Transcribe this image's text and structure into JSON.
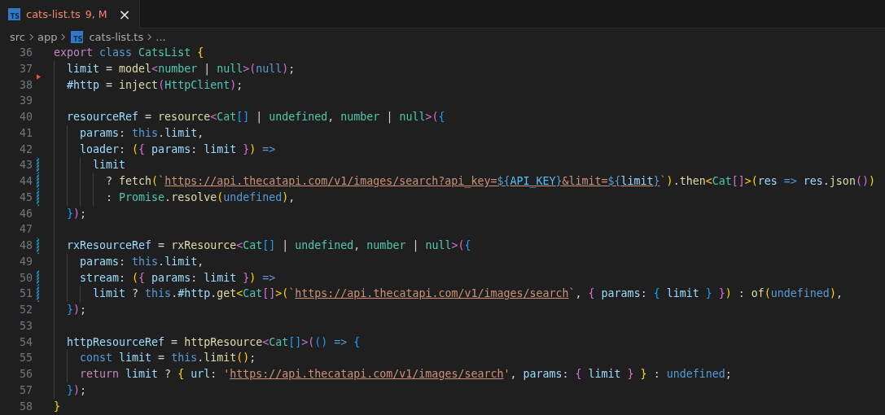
{
  "tabs": [
    {
      "icon_text": "TS",
      "label": "cats-list.ts",
      "status": "9, M",
      "close": "×",
      "selected": true
    }
  ],
  "breadcrumb": [
    {
      "text": "src"
    },
    {
      "text": "app"
    },
    {
      "text": "cats-list.ts",
      "icon_text": "TS"
    },
    {
      "text": "..."
    }
  ],
  "lines": [
    {
      "number": "36",
      "modified": false,
      "deleted_above": false,
      "tokens": [
        {
          "text": "export ",
          "kind": "ctl"
        },
        {
          "text": "class ",
          "kind": "kw"
        },
        {
          "text": "CatsList ",
          "kind": "ty"
        },
        {
          "text": "{",
          "kind": "b1"
        }
      ]
    },
    {
      "number": "37",
      "modified": false,
      "deleted_above": false,
      "tokens": [
        {
          "text": "  limit",
          "kind": "var"
        },
        {
          "text": " = ",
          "kind": "plain"
        },
        {
          "text": "model",
          "kind": "fn"
        },
        {
          "text": "<",
          "kind": "b2"
        },
        {
          "text": "number",
          "kind": "ty"
        },
        {
          "text": " | ",
          "kind": "plain"
        },
        {
          "text": "null",
          "kind": "ty"
        },
        {
          "text": ">(",
          "kind": "b2"
        },
        {
          "text": "null",
          "kind": "kw"
        },
        {
          "text": ")",
          "kind": "b2"
        },
        {
          "text": ";",
          "kind": "plain"
        }
      ]
    },
    {
      "number": "38",
      "modified": false,
      "deleted_above": true,
      "tokens": [
        {
          "text": "  #http",
          "kind": "var"
        },
        {
          "text": " = ",
          "kind": "plain"
        },
        {
          "text": "inject",
          "kind": "fn"
        },
        {
          "text": "(",
          "kind": "b2"
        },
        {
          "text": "HttpClient",
          "kind": "ty"
        },
        {
          "text": ")",
          "kind": "b2"
        },
        {
          "text": ";",
          "kind": "plain"
        }
      ]
    },
    {
      "number": "39",
      "modified": false,
      "deleted_above": false
    },
    {
      "number": "40",
      "modified": false,
      "deleted_above": false,
      "tokens": [
        {
          "text": "  resourceRef",
          "kind": "var"
        },
        {
          "text": " = ",
          "kind": "plain"
        },
        {
          "text": "resource",
          "kind": "fn"
        },
        {
          "text": "<",
          "kind": "b2"
        },
        {
          "text": "Cat",
          "kind": "ty"
        },
        {
          "text": "[]",
          "kind": "b3"
        },
        {
          "text": " | ",
          "kind": "plain"
        },
        {
          "text": "undefined",
          "kind": "ty"
        },
        {
          "text": ", ",
          "kind": "plain"
        },
        {
          "text": "number",
          "kind": "ty"
        },
        {
          "text": " | ",
          "kind": "plain"
        },
        {
          "text": "null",
          "kind": "ty"
        },
        {
          "text": ">(",
          "kind": "b2"
        },
        {
          "text": "{",
          "kind": "b3"
        }
      ]
    },
    {
      "number": "41",
      "modified": false,
      "deleted_above": false,
      "tokens": [
        {
          "text": "    params",
          "kind": "var"
        },
        {
          "text": ": ",
          "kind": "plain"
        },
        {
          "text": "this",
          "kind": "kw"
        },
        {
          "text": ".",
          "kind": "plain"
        },
        {
          "text": "limit",
          "kind": "var"
        },
        {
          "text": ",",
          "kind": "plain"
        }
      ]
    },
    {
      "number": "42",
      "modified": false,
      "deleted_above": false,
      "tokens": [
        {
          "text": "    loader",
          "kind": "var"
        },
        {
          "text": ": ",
          "kind": "plain"
        },
        {
          "text": "(",
          "kind": "b1"
        },
        {
          "text": "{",
          "kind": "b2"
        },
        {
          "text": " params",
          "kind": "var"
        },
        {
          "text": ": ",
          "kind": "plain"
        },
        {
          "text": "limit ",
          "kind": "var"
        },
        {
          "text": "}",
          "kind": "b2"
        },
        {
          "text": ")",
          "kind": "b1"
        },
        {
          "text": " =>",
          "kind": "kw"
        }
      ]
    },
    {
      "number": "43",
      "modified": true,
      "deleted_above": false,
      "tokens": [
        {
          "text": "      limit",
          "kind": "var"
        }
      ]
    },
    {
      "number": "44",
      "modified": true,
      "deleted_above": false,
      "tokens": [
        {
          "text": "        ? ",
          "kind": "plain"
        },
        {
          "text": "fetch",
          "kind": "fn"
        },
        {
          "text": "(",
          "kind": "b1"
        },
        {
          "text": "`",
          "kind": "str"
        },
        {
          "text": "https://api.thecatapi.com/v1/images/search?api_key=",
          "kind": "url"
        },
        {
          "text": "${",
          "kind": "interp"
        },
        {
          "text": "API_KEY",
          "kind": "iconst"
        },
        {
          "text": "}",
          "kind": "interp"
        },
        {
          "text": "&limit=",
          "kind": "url"
        },
        {
          "text": "${",
          "kind": "interp"
        },
        {
          "text": "limit",
          "kind": "ivar"
        },
        {
          "text": "}",
          "kind": "interp"
        },
        {
          "text": "`",
          "kind": "str"
        },
        {
          "text": ")",
          "kind": "b1"
        },
        {
          "text": ".",
          "kind": "plain"
        },
        {
          "text": "then",
          "kind": "fn"
        },
        {
          "text": "<",
          "kind": "b1"
        },
        {
          "text": "Cat",
          "kind": "ty"
        },
        {
          "text": "[]",
          "kind": "b2"
        },
        {
          "text": ">(",
          "kind": "b1"
        },
        {
          "text": "res",
          "kind": "var"
        },
        {
          "text": " =>",
          "kind": "kw"
        },
        {
          "text": " res",
          "kind": "var"
        },
        {
          "text": ".",
          "kind": "plain"
        },
        {
          "text": "json",
          "kind": "fn"
        },
        {
          "text": "()",
          "kind": "b2"
        },
        {
          "text": ")",
          "kind": "b1"
        }
      ]
    },
    {
      "number": "45",
      "modified": true,
      "deleted_above": false,
      "tokens": [
        {
          "text": "        : ",
          "kind": "plain"
        },
        {
          "text": "Promise",
          "kind": "ty"
        },
        {
          "text": ".",
          "kind": "plain"
        },
        {
          "text": "resolve",
          "kind": "fn"
        },
        {
          "text": "(",
          "kind": "b1"
        },
        {
          "text": "undefined",
          "kind": "kw"
        },
        {
          "text": ")",
          "kind": "b1"
        },
        {
          "text": ",",
          "kind": "plain"
        }
      ]
    },
    {
      "number": "46",
      "modified": false,
      "deleted_above": false,
      "tokens": [
        {
          "text": "  }",
          "kind": "b3"
        },
        {
          "text": ")",
          "kind": "b2"
        },
        {
          "text": ";",
          "kind": "plain"
        }
      ]
    },
    {
      "number": "47",
      "modified": false,
      "deleted_above": false
    },
    {
      "number": "48",
      "modified": true,
      "deleted_above": false,
      "tokens": [
        {
          "text": "  rxResourceRef",
          "kind": "var"
        },
        {
          "text": " = ",
          "kind": "plain"
        },
        {
          "text": "rxResource",
          "kind": "fn"
        },
        {
          "text": "<",
          "kind": "b2"
        },
        {
          "text": "Cat",
          "kind": "ty"
        },
        {
          "text": "[]",
          "kind": "b3"
        },
        {
          "text": " | ",
          "kind": "plain"
        },
        {
          "text": "undefined",
          "kind": "ty"
        },
        {
          "text": ", ",
          "kind": "plain"
        },
        {
          "text": "number",
          "kind": "ty"
        },
        {
          "text": " | ",
          "kind": "plain"
        },
        {
          "text": "null",
          "kind": "ty"
        },
        {
          "text": ">(",
          "kind": "b2"
        },
        {
          "text": "{",
          "kind": "b3"
        }
      ]
    },
    {
      "number": "49",
      "modified": false,
      "deleted_above": false,
      "tokens": [
        {
          "text": "    params",
          "kind": "var"
        },
        {
          "text": ": ",
          "kind": "plain"
        },
        {
          "text": "this",
          "kind": "kw"
        },
        {
          "text": ".",
          "kind": "plain"
        },
        {
          "text": "limit",
          "kind": "var"
        },
        {
          "text": ",",
          "kind": "plain"
        }
      ]
    },
    {
      "number": "50",
      "modified": true,
      "deleted_above": false,
      "tokens": [
        {
          "text": "    stream",
          "kind": "var"
        },
        {
          "text": ": ",
          "kind": "plain"
        },
        {
          "text": "(",
          "kind": "b1"
        },
        {
          "text": "{",
          "kind": "b2"
        },
        {
          "text": " params",
          "kind": "var"
        },
        {
          "text": ": ",
          "kind": "plain"
        },
        {
          "text": "limit ",
          "kind": "var"
        },
        {
          "text": "}",
          "kind": "b2"
        },
        {
          "text": ")",
          "kind": "b1"
        },
        {
          "text": " =>",
          "kind": "kw"
        }
      ]
    },
    {
      "number": "51",
      "modified": true,
      "deleted_above": false,
      "tokens": [
        {
          "text": "      limit",
          "kind": "var"
        },
        {
          "text": " ? ",
          "kind": "plain"
        },
        {
          "text": "this",
          "kind": "kw"
        },
        {
          "text": ".",
          "kind": "plain"
        },
        {
          "text": "#http",
          "kind": "var"
        },
        {
          "text": ".",
          "kind": "plain"
        },
        {
          "text": "get",
          "kind": "fn"
        },
        {
          "text": "<",
          "kind": "b1"
        },
        {
          "text": "Cat",
          "kind": "ty"
        },
        {
          "text": "[]",
          "kind": "b2"
        },
        {
          "text": ">(",
          "kind": "b1"
        },
        {
          "text": "`",
          "kind": "str"
        },
        {
          "text": "https://api.thecatapi.com/v1/images/search",
          "kind": "url"
        },
        {
          "text": "`",
          "kind": "str"
        },
        {
          "text": ", ",
          "kind": "plain"
        },
        {
          "text": "{",
          "kind": "b2"
        },
        {
          "text": " params",
          "kind": "var"
        },
        {
          "text": ": ",
          "kind": "plain"
        },
        {
          "text": "{",
          "kind": "b3"
        },
        {
          "text": " limit ",
          "kind": "var"
        },
        {
          "text": "}",
          "kind": "b3"
        },
        {
          "text": " }",
          "kind": "b2"
        },
        {
          "text": ")",
          "kind": "b1"
        },
        {
          "text": " : ",
          "kind": "plain"
        },
        {
          "text": "of",
          "kind": "fn"
        },
        {
          "text": "(",
          "kind": "b1"
        },
        {
          "text": "undefined",
          "kind": "kw"
        },
        {
          "text": ")",
          "kind": "b1"
        },
        {
          "text": ",",
          "kind": "plain"
        }
      ]
    },
    {
      "number": "52",
      "modified": false,
      "deleted_above": false,
      "tokens": [
        {
          "text": "  }",
          "kind": "b3"
        },
        {
          "text": ")",
          "kind": "b2"
        },
        {
          "text": ";",
          "kind": "plain"
        }
      ]
    },
    {
      "number": "53",
      "modified": false,
      "deleted_above": false
    },
    {
      "number": "54",
      "modified": false,
      "deleted_above": false,
      "tokens": [
        {
          "text": "  httpResourceRef",
          "kind": "var"
        },
        {
          "text": " = ",
          "kind": "plain"
        },
        {
          "text": "httpResource",
          "kind": "fn"
        },
        {
          "text": "<",
          "kind": "b2"
        },
        {
          "text": "Cat",
          "kind": "ty"
        },
        {
          "text": "[]",
          "kind": "b3"
        },
        {
          "text": ">(",
          "kind": "b2"
        },
        {
          "text": "()",
          "kind": "b3"
        },
        {
          "text": " =>",
          "kind": "kw"
        },
        {
          "text": " {",
          "kind": "b3"
        }
      ]
    },
    {
      "number": "55",
      "modified": false,
      "deleted_above": false,
      "tokens": [
        {
          "text": "    const ",
          "kind": "kw"
        },
        {
          "text": "limit",
          "kind": "var"
        },
        {
          "text": " = ",
          "kind": "plain"
        },
        {
          "text": "this",
          "kind": "kw"
        },
        {
          "text": ".",
          "kind": "plain"
        },
        {
          "text": "limit",
          "kind": "fn"
        },
        {
          "text": "()",
          "kind": "b1"
        },
        {
          "text": ";",
          "kind": "plain"
        }
      ]
    },
    {
      "number": "56",
      "modified": false,
      "deleted_above": false,
      "tokens": [
        {
          "text": "    return ",
          "kind": "ctl"
        },
        {
          "text": "limit",
          "kind": "var"
        },
        {
          "text": " ? ",
          "kind": "plain"
        },
        {
          "text": "{",
          "kind": "b1"
        },
        {
          "text": " url",
          "kind": "var"
        },
        {
          "text": ": ",
          "kind": "plain"
        },
        {
          "text": "'",
          "kind": "str"
        },
        {
          "text": "https://api.thecatapi.com/v1/images/search",
          "kind": "url"
        },
        {
          "text": "'",
          "kind": "str"
        },
        {
          "text": ", ",
          "kind": "plain"
        },
        {
          "text": "params",
          "kind": "var"
        },
        {
          "text": ": ",
          "kind": "plain"
        },
        {
          "text": "{",
          "kind": "b2"
        },
        {
          "text": " limit ",
          "kind": "var"
        },
        {
          "text": "}",
          "kind": "b2"
        },
        {
          "text": " }",
          "kind": "b1"
        },
        {
          "text": " : ",
          "kind": "plain"
        },
        {
          "text": "undefined",
          "kind": "kw"
        },
        {
          "text": ";",
          "kind": "plain"
        }
      ]
    },
    {
      "number": "57",
      "modified": false,
      "deleted_above": false,
      "tokens": [
        {
          "text": "  }",
          "kind": "b3"
        },
        {
          "text": ")",
          "kind": "b2"
        },
        {
          "text": ";",
          "kind": "plain"
        }
      ]
    },
    {
      "number": "58",
      "modified": false,
      "deleted_above": false,
      "tokens": [
        {
          "text": "}",
          "kind": "b1"
        }
      ]
    }
  ]
}
